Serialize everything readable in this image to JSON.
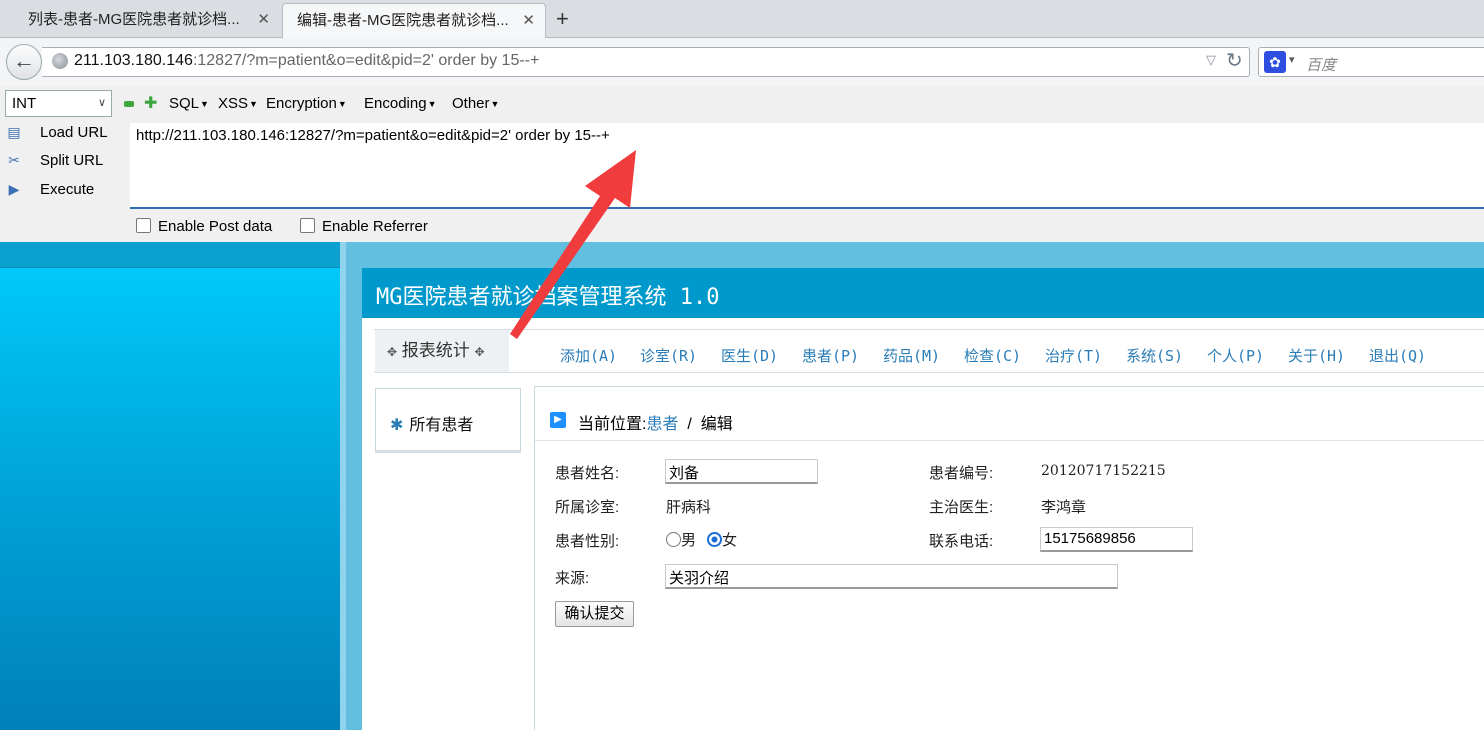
{
  "tabs": [
    {
      "label": "列表-患者-MG医院患者就诊档...",
      "active": false
    },
    {
      "label": "编辑-患者-MG医院患者就诊档...",
      "active": true
    }
  ],
  "tab_close": "✕",
  "new_tab": "+",
  "nav": {
    "url_host": "211.103.180.146",
    "url_rest": ":12827/?m=patient&o=edit&pid=2' order by 15--+",
    "search_placeholder": "百度"
  },
  "hackbar": {
    "encoding_select": "INT",
    "menus": [
      "SQL",
      "XSS",
      "Encryption",
      "Encoding",
      "Other"
    ],
    "actions": {
      "load_url": "Load URL",
      "split_url": "Split URL",
      "execute": "Execute"
    },
    "url_text": "http://211.103.180.146:12827/?m=patient&o=edit&pid=2' order by 15--+",
    "enable_post": "Enable Post data",
    "enable_referrer": "Enable Referrer"
  },
  "app": {
    "title": "MG医院患者就诊档案管理系统 1.0",
    "menu_title": "报表统计",
    "nav_items": [
      "添加(A)",
      "诊室(R)",
      "医生(D)",
      "患者(P)",
      "药品(M)",
      "检查(C)",
      "治疗(T)",
      "系统(S)",
      "个人(P)",
      "关于(H)",
      "退出(Q)"
    ],
    "sidebar_item": "所有患者",
    "breadcrumb": {
      "prefix": "当前位置:",
      "link": "患者",
      "sep": "/",
      "current": "编辑"
    }
  },
  "form": {
    "name_label": "患者姓名:",
    "name_value": "刘备",
    "id_label": "患者编号:",
    "id_value": "20120717152215",
    "clinic_label": "所属诊室:",
    "clinic_value": "肝病科",
    "doctor_label": "主治医生:",
    "doctor_value": "李鸿章",
    "gender_label": "患者性别:",
    "gender_male": "男",
    "gender_female": "女",
    "gender_selected": "女",
    "phone_label": "联系电话:",
    "phone_value": "15175689856",
    "source_label": "来源:",
    "source_value": "关羽介绍",
    "submit_label": "确认提交"
  },
  "colors": {
    "app_header": "#0099cc",
    "link": "#2a7db7",
    "annotation_arrow": "#f03c3c"
  }
}
